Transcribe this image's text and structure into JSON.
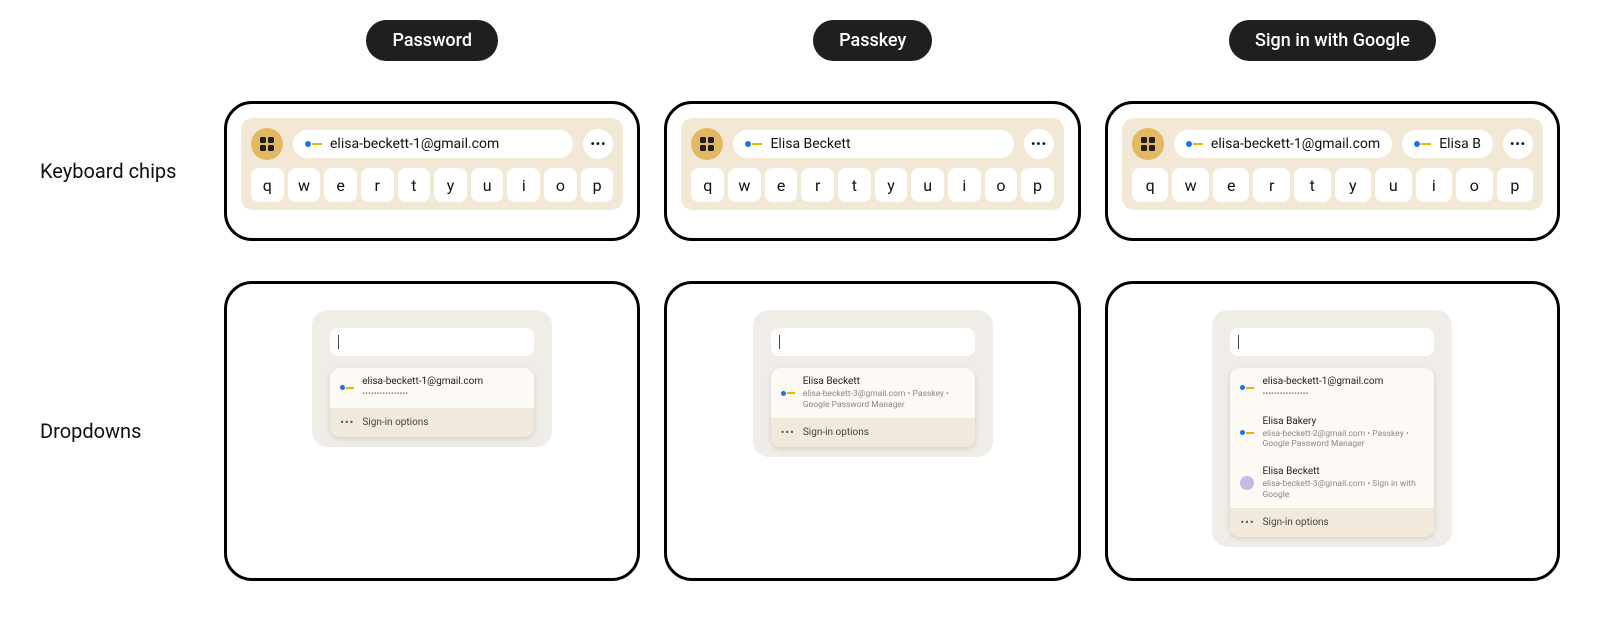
{
  "rows": {
    "r1": "Keyboard chips",
    "r2": "Dropdowns"
  },
  "cols": {
    "c1": "Password",
    "c2": "Passkey",
    "c3": "Sign in with Google"
  },
  "keys": [
    "q",
    "w",
    "e",
    "r",
    "t",
    "y",
    "u",
    "i",
    "o",
    "p"
  ],
  "chips": {
    "password": {
      "primary": "elisa-beckett-1@gmail.com"
    },
    "passkey": {
      "primary": "Elisa Beckett"
    },
    "siwg": {
      "primary": "elisa-beckett-1@gmail.com",
      "secondary": "Elisa B"
    }
  },
  "dropdowns": {
    "password": {
      "items": [
        {
          "icon": "key",
          "title": "elisa-beckett-1@gmail.com",
          "sub": "••••••••••••••••"
        }
      ],
      "footer": "Sign-in options"
    },
    "passkey": {
      "items": [
        {
          "icon": "key",
          "title": "Elisa Beckett",
          "sub": "elisa-beckett-3@gmail.com • Passkey • Google Password Manager"
        }
      ],
      "footer": "Sign-in options"
    },
    "siwg": {
      "items": [
        {
          "icon": "key",
          "title": "elisa-beckett-1@gmail.com",
          "sub": "••••••••••••••••"
        },
        {
          "icon": "key",
          "title": "Elisa Bakery",
          "sub": "elisa-beckett-2@gmail.com • Passkey • Google Password Manager"
        },
        {
          "icon": "avatar",
          "title": "Elisa Beckett",
          "sub": "elisa-beckett-3@gmail.com • Sign in with Google"
        }
      ],
      "footer": "Sign-in options"
    }
  }
}
